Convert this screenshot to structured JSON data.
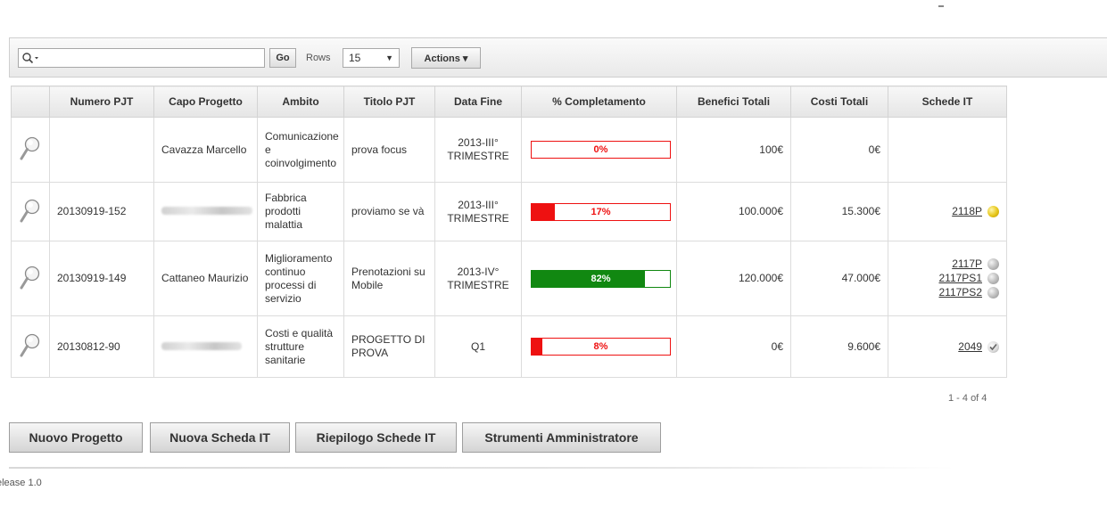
{
  "toolbar": {
    "search_value": "",
    "go_label": "Go",
    "rows_label": "Rows",
    "rows_value": "15",
    "actions_label": "Actions ▾"
  },
  "table": {
    "headers": [
      "",
      "Numero PJT",
      "Capo Progetto",
      "Ambito",
      "Titolo PJT",
      "Data Fine",
      "% Completamento",
      "Benefici Totali",
      "Costi Totali",
      "Schede IT"
    ],
    "rows": [
      {
        "numero": "",
        "capo": "Cavazza Marcello",
        "capo_blurred": false,
        "ambito": "Comunicazione e coinvolgimento",
        "titolo": "prova focus",
        "data_fine": "2013-III° TRIMESTRE",
        "completamento": 0,
        "completamento_label": "0%",
        "benefici": "100€",
        "costi": "0€",
        "schede": []
      },
      {
        "numero": "20130919-152",
        "capo": "",
        "capo_blurred": true,
        "ambito": "Fabbrica prodotti malattia",
        "titolo": "proviamo se và",
        "data_fine": "2013-III° TRIMESTRE",
        "completamento": 17,
        "completamento_label": "17%",
        "benefici": "100.000€",
        "costi": "15.300€",
        "schede": [
          {
            "label": "2118P",
            "status": "yellow"
          }
        ]
      },
      {
        "numero": "20130919-149",
        "capo": "Cattaneo Maurizio",
        "capo_blurred": false,
        "ambito": "Miglioramento continuo processi di servizio",
        "titolo": "Prenotazioni su Mobile",
        "data_fine": "2013-IV° TRIMESTRE",
        "completamento": 82,
        "completamento_label": "82%",
        "benefici": "120.000€",
        "costi": "47.000€",
        "schede": [
          {
            "label": "2117P",
            "status": "grey"
          },
          {
            "label": "2117PS1",
            "status": "grey"
          },
          {
            "label": "2117PS2",
            "status": "grey"
          }
        ]
      },
      {
        "numero": "20130812-90",
        "capo": "",
        "capo_blurred": true,
        "ambito": "Costi e qualità strutture sanitarie",
        "titolo": "PROGETTO DI PROVA",
        "data_fine": "Q1",
        "completamento": 8,
        "completamento_label": "8%",
        "benefici": "0€",
        "costi": "9.600€",
        "schede": [
          {
            "label": "2049",
            "status": "check"
          }
        ]
      }
    ]
  },
  "pagination": "1 - 4 of 4",
  "buttons": {
    "nuovo_progetto": "Nuovo Progetto",
    "nuova_scheda": "Nuova Scheda IT",
    "riepilogo": "Riepilogo Schede IT",
    "strumenti": "Strumenti Amministratore"
  },
  "footer": {
    "release": "elease 1.0"
  },
  "colors": {
    "progress_border": "#ee1111",
    "progress_red": "#ee1111",
    "progress_green": "#118811",
    "status_yellow": "#e6c619",
    "status_grey": "#b5b5b5"
  }
}
